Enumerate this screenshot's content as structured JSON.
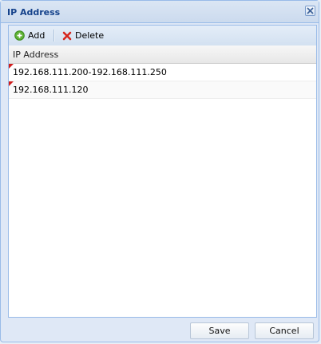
{
  "window": {
    "title": "IP Address",
    "close_icon": "close-icon"
  },
  "toolbar": {
    "add_label": "Add",
    "add_icon": "add-circle-icon",
    "delete_label": "Delete",
    "delete_icon": "delete-x-icon"
  },
  "grid": {
    "column_header": "IP Address",
    "rows": [
      {
        "ip": "192.168.111.200-192.168.111.250",
        "modified": true
      },
      {
        "ip": "192.168.111.120",
        "modified": true
      }
    ]
  },
  "footer": {
    "save_label": "Save",
    "cancel_label": "Cancel"
  },
  "colors": {
    "title_text": "#15428b",
    "border": "#99bbe8",
    "dirty_marker": "#d11c1c"
  }
}
